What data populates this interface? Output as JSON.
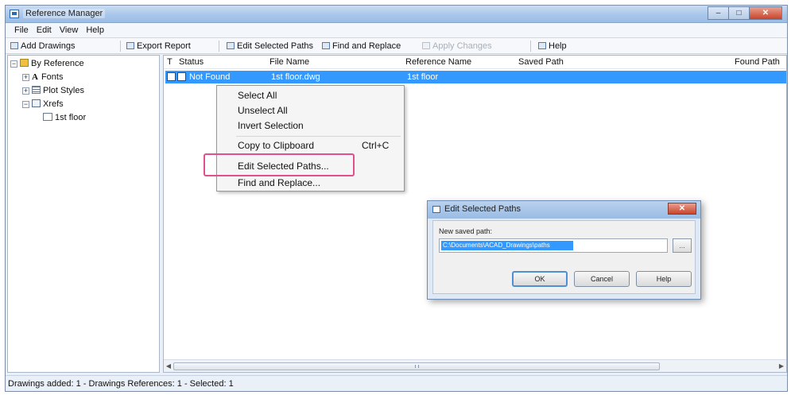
{
  "window": {
    "title": "Reference Manager",
    "controls": [
      "–",
      "□",
      "✕"
    ]
  },
  "menubar": {
    "items": [
      "File",
      "Edit",
      "View",
      "Help"
    ]
  },
  "toolbar": {
    "add_drawings": "Add Drawings",
    "export_report": "Export Report",
    "edit_selected_paths": "Edit Selected Paths",
    "find_and_replace": "Find and Replace",
    "apply_changes": "Apply Changes",
    "help": "Help"
  },
  "tree": {
    "root": "By Reference",
    "fonts": "Fonts",
    "fonts_icon_glyph": "A",
    "plot_styles": "Plot Styles",
    "xrefs": "Xrefs",
    "first_floor": "1st floor",
    "expander_expanded": "−",
    "expander_collapsed": "+"
  },
  "list": {
    "columns": {
      "type": "T",
      "status": "Status",
      "file_name": "File Name",
      "reference_name": "Reference Name",
      "saved_path": "Saved Path",
      "found_path": "Found Path"
    },
    "selected_row": {
      "status": "Not Found",
      "file_name": "1st floor.dwg",
      "reference_name": "1st floor"
    }
  },
  "context_menu": {
    "select_all": "Select All",
    "unselect_all": "Unselect All",
    "invert_selection": "Invert Selection",
    "copy_to_clipboard": "Copy to Clipboard",
    "copy_shortcut": "Ctrl+C",
    "edit_selected_paths": "Edit Selected Paths...",
    "find_and_replace": "Find and Replace..."
  },
  "dialog": {
    "title": "Edit Selected Paths",
    "label": "New saved path:",
    "input_value": "C:\\Documents\\ACAD_Drawings\\paths",
    "browse": "...",
    "ok": "OK",
    "cancel": "Cancel",
    "help": "Help"
  },
  "statusbar": {
    "text": "Drawings added: 1  -  Drawings References: 1  -  Selected: 1"
  },
  "colors": {
    "selection": "#3399ff",
    "highlight_box": "#e0508f",
    "titlebar": "#a9c6ea"
  }
}
